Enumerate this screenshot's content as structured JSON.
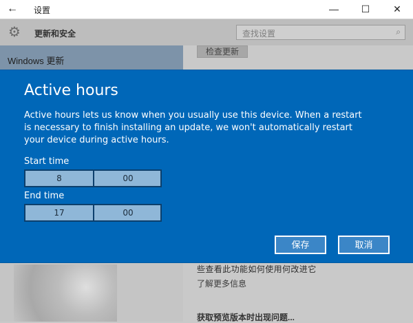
{
  "window": {
    "title": "设置",
    "back_icon": "arrow-left-icon",
    "minimize_glyph": "—",
    "maximize_glyph": "☐",
    "close_glyph": "✕"
  },
  "header": {
    "gear_icon": "gear-icon",
    "section_title": "更新和安全",
    "search_placeholder": "查找设置",
    "search_icon": "search-icon"
  },
  "sidebar": {
    "selected_item": "Windows 更新"
  },
  "content": {
    "check_button": "检查更新",
    "line_fragment": "些查看此功能如何使用何改进它",
    "learn_more": "了解更多信息",
    "preview_issue": "获取预览版本时出现问题..."
  },
  "dialog": {
    "title": "Active hours",
    "description": "Active hours lets us know when you usually use this device. When a restart is necessary to finish installing an update, we won't automatically restart your device during active hours.",
    "start_label": "Start time",
    "start_hour": "8",
    "start_minute": "00",
    "end_label": "End time",
    "end_hour": "17",
    "end_minute": "00",
    "save_label": "保存",
    "cancel_label": "取消"
  },
  "colors": {
    "dialog_bg": "#0067b8",
    "picker_bg": "#8fb7d8",
    "button_bg": "#3b86c7"
  }
}
